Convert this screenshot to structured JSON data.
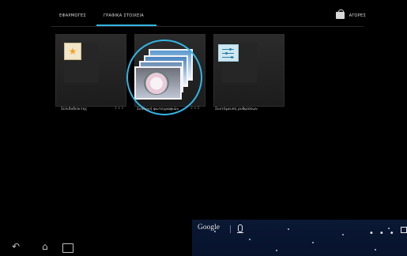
{
  "tabs": [
    {
      "label": "ΕΦΑΡΜΟΓΕΣ",
      "active": false
    },
    {
      "label": "ΓΡΑΦΙΚΑ ΣΤΟΙΧΕΙΑ",
      "active": true
    }
  ],
  "store": {
    "label": "ΑΓΟΡΕΣ",
    "icon": "store-icon"
  },
  "widgets": [
    {
      "label": "Σελιδοδείκτης",
      "size": "1 x 1"
    },
    {
      "label": "Συλλογή φωτογραφιών",
      "size": "2 x 2"
    },
    {
      "label": "Συντόμευση ρυθμίσεων",
      "size": ""
    }
  ],
  "search": {
    "brand": "Google",
    "icon_search": "google-logo",
    "icon_mic": "mic-icon"
  },
  "nav": {
    "back_icon": "back-icon",
    "home_icon": "home-icon",
    "recent_icon": "recent-apps-icon"
  },
  "colors": {
    "accent": "#33b5e5",
    "star": "#f4a226"
  }
}
